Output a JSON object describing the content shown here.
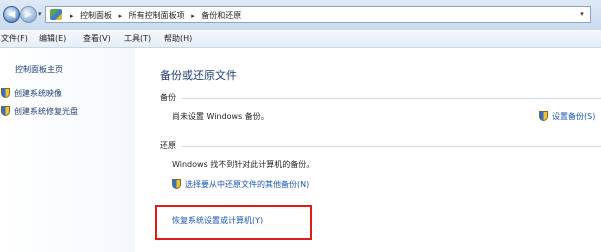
{
  "address_bar": {
    "breadcrumbs": [
      "控制面板",
      "所有控制面板项",
      "备份和还原"
    ]
  },
  "menu": {
    "items": [
      "文件(F)",
      "编辑(E)",
      "查看(V)",
      "工具(T)",
      "帮助(H)"
    ]
  },
  "nav": {
    "home": "控制面板主页",
    "links": [
      "创建系统映像",
      "创建系统修复光盘"
    ]
  },
  "main": {
    "title": "备份或还原文件",
    "backup": {
      "heading": "备份",
      "status": "尚未设置 Windows 备份。",
      "setup_link": "设置备份(S)"
    },
    "restore": {
      "heading": "还原",
      "status": "Windows 找不到针对此计算机的备份。",
      "other_backup_link": "选择要从中还原文件的其他备份(N)",
      "recover_link": "恢复系统设置或计算机(Y)"
    }
  },
  "colors": {
    "link": "#1a56b8",
    "highlight": "#e01b1b"
  }
}
